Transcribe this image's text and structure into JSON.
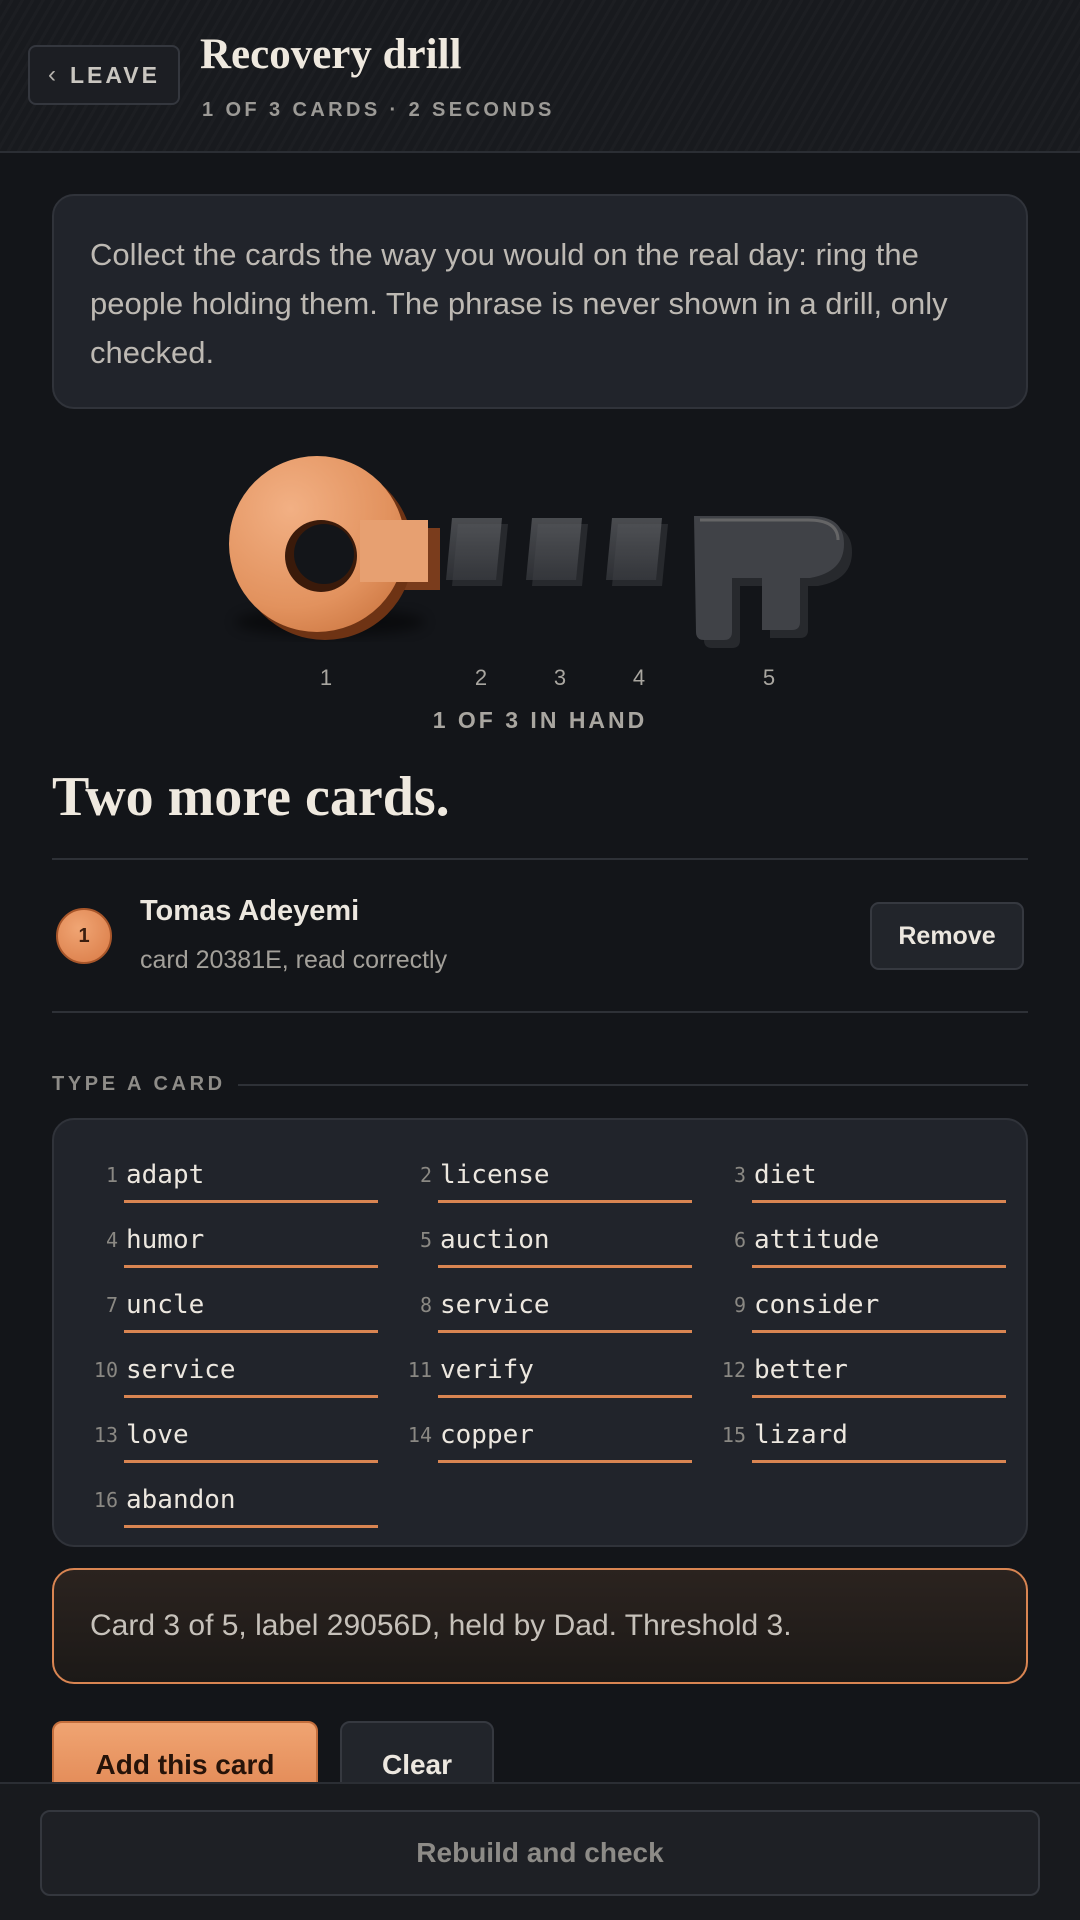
{
  "header": {
    "leave_label": "LEAVE",
    "title": "Recovery drill",
    "subtitle": "1 OF 3 CARDS · 2 SECONDS"
  },
  "info_text": "Collect the cards the way you would on the real day: ring the people holding them. The phrase is never shown in a drill, only checked.",
  "key": {
    "shares_collected": 1,
    "shares_total": 5,
    "threshold": 3,
    "labels": [
      "1",
      "2",
      "3",
      "4",
      "5"
    ],
    "collected_color": "#e2925e",
    "pending_color": "#4a4c51"
  },
  "in_hand": "1 OF 3 IN HAND",
  "heading": "Two more cards.",
  "holder": {
    "badge": "1",
    "name": "Tomas Adeyemi",
    "note": "card 20381E, read correctly",
    "remove_label": "Remove"
  },
  "type_section": {
    "label": "TYPE A CARD",
    "words": [
      {
        "n": "1",
        "w": "adapt"
      },
      {
        "n": "2",
        "w": "license"
      },
      {
        "n": "3",
        "w": "diet"
      },
      {
        "n": "4",
        "w": "humor"
      },
      {
        "n": "5",
        "w": "auction"
      },
      {
        "n": "6",
        "w": "attitude"
      },
      {
        "n": "7",
        "w": "uncle"
      },
      {
        "n": "8",
        "w": "service"
      },
      {
        "n": "9",
        "w": "consider"
      },
      {
        "n": "10",
        "w": "service"
      },
      {
        "n": "11",
        "w": "verify"
      },
      {
        "n": "12",
        "w": "better"
      },
      {
        "n": "13",
        "w": "love"
      },
      {
        "n": "14",
        "w": "copper"
      },
      {
        "n": "15",
        "w": "lizard"
      },
      {
        "n": "16",
        "w": "abandon"
      }
    ]
  },
  "result_text": "Card 3 of 5, label 29056D, held by Dad. Threshold 3.",
  "actions": {
    "add_label": "Add this card",
    "clear_label": "Clear"
  },
  "bottom": {
    "rebuild_label": "Rebuild and check"
  },
  "colors": {
    "accent": "#d98552",
    "background": "#131519",
    "surface": "#21242b"
  }
}
